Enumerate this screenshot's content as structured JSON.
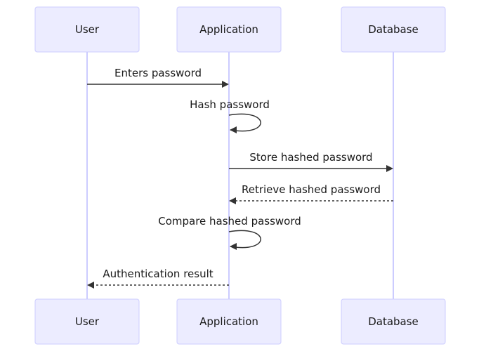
{
  "participants": [
    {
      "id": "user",
      "label": "User"
    },
    {
      "id": "app",
      "label": "Application"
    },
    {
      "id": "db",
      "label": "Database"
    }
  ],
  "messages": [
    {
      "from": "user",
      "to": "app",
      "label": "Enters password",
      "style": "solid"
    },
    {
      "from": "app",
      "to": "app",
      "label": "Hash password",
      "style": "solid"
    },
    {
      "from": "app",
      "to": "db",
      "label": "Store hashed password",
      "style": "solid"
    },
    {
      "from": "db",
      "to": "app",
      "label": "Retrieve hashed password",
      "style": "dashed"
    },
    {
      "from": "app",
      "to": "app",
      "label": "Compare hashed password",
      "style": "solid"
    },
    {
      "from": "app",
      "to": "user",
      "label": "Authentication result",
      "style": "dashed"
    }
  ],
  "colors": {
    "actor_fill": "#ECECFF",
    "actor_stroke": "#CCCCFF",
    "lifeline": "#CCCCFF",
    "message_line": "#333333"
  }
}
